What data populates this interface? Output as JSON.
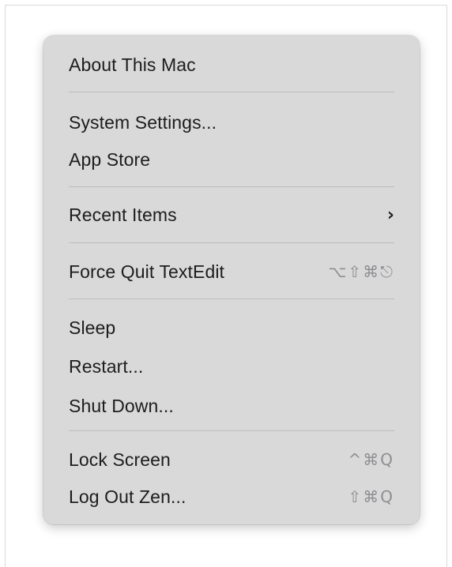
{
  "menu": {
    "about": "About This Mac",
    "system_settings": "System Settings...",
    "app_store": "App Store",
    "recent_items": "Recent Items",
    "recent_items_chevron": "›",
    "force_quit": "Force Quit TextEdit",
    "force_quit_shortcut": "⌥⇧⌘⎋",
    "sleep": "Sleep",
    "restart": "Restart...",
    "shut_down": "Shut Down...",
    "lock_screen": "Lock Screen",
    "lock_screen_shortcut": "^⌘Q",
    "log_out": "Log Out Zen...",
    "log_out_shortcut": "⇧⌘Q"
  }
}
